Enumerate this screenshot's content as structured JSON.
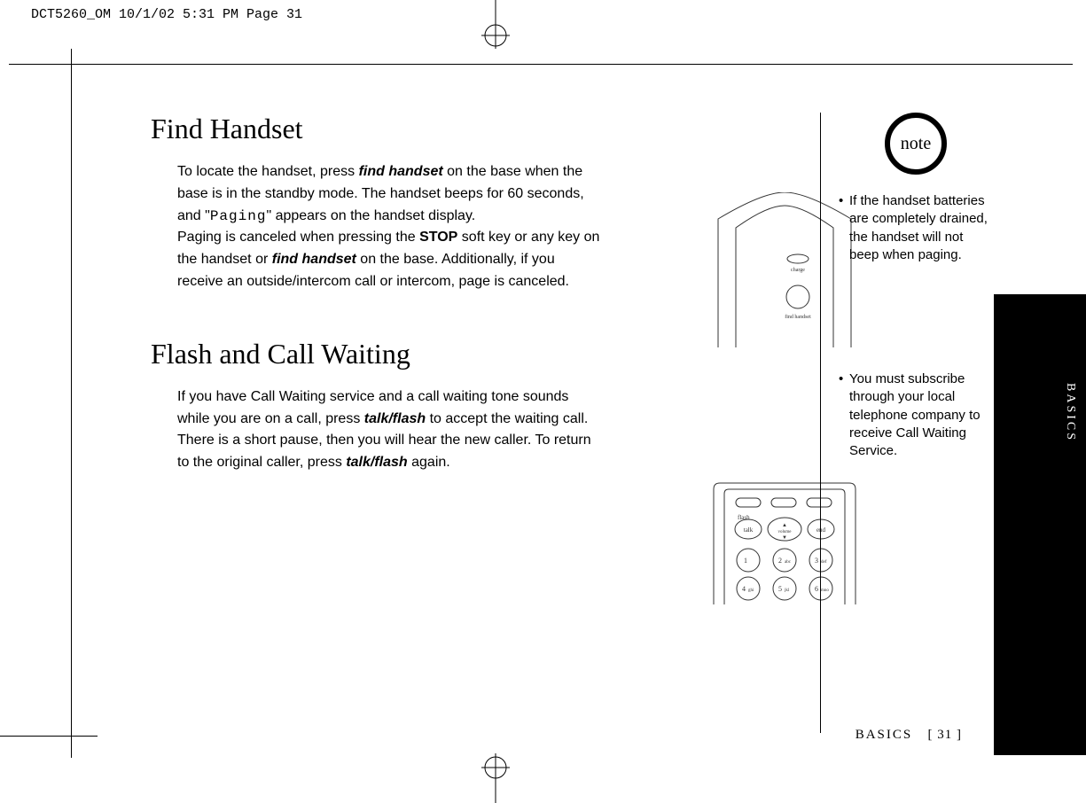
{
  "print_header": "DCT5260_OM  10/1/02  5:31 PM  Page 31",
  "section1": {
    "heading": "Find Handset",
    "p1a": "To locate the handset, press ",
    "p1b": "find handset",
    "p1c": " on the base when the base is in the standby mode. The handset beeps for 60 seconds, and \"",
    "p1d": "Paging",
    "p1e": "\" appears on the handset display.",
    "p2a": "Paging is canceled when pressing the ",
    "p2b": "STOP",
    "p2c": " soft key or any key on the handset or ",
    "p2d": "find handset",
    "p2e": " on the base. Additionally, if you receive an outside/intercom call or intercom, page is canceled."
  },
  "section2": {
    "heading": "Flash and Call Waiting",
    "p1a": "If you have Call Waiting service and a call waiting tone sounds while you are on a call, press ",
    "p1b": "talk/flash",
    "p1c": " to accept the waiting call. There is a short pause, then you will hear the new caller. To return to the original caller, press ",
    "p1d": "talk/flash",
    "p1e": " again."
  },
  "sidebar": {
    "note_label": "note",
    "item1": "If the handset batteries are completely drained, the handset will not beep when paging.",
    "item2": "You must subscribe through your local telephone company to receive Call Waiting Service."
  },
  "side_tab": "BASICS",
  "footer_section": "BASICS",
  "footer_page": "[ 31 ]",
  "illus1_labels": {
    "charge": "charge",
    "find": "find handset"
  },
  "illus2_labels": {
    "flash": "flash",
    "talk": "talk",
    "volume": "volume",
    "end": "end",
    "k1": "1",
    "k2": "2",
    "k2t": "abc",
    "k3": "3",
    "k3t": "def",
    "k4": "4",
    "k4t": "ghi",
    "k5": "5",
    "k5t": "jkl",
    "k6": "6",
    "k6t": "mno"
  }
}
